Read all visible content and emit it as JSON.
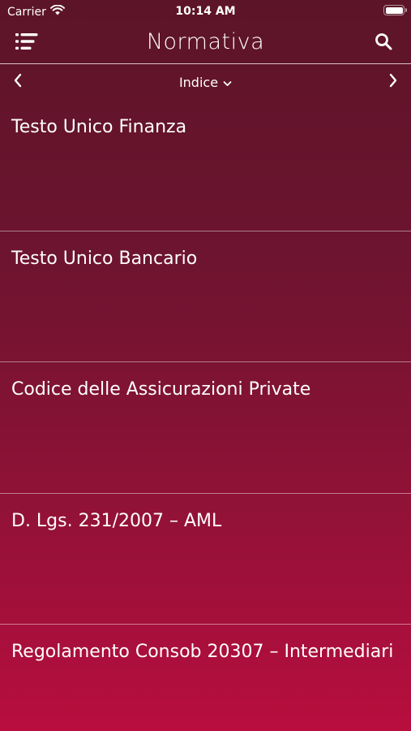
{
  "status_bar": {
    "carrier": "Carrier",
    "time": "10:14 AM",
    "battery_level": 1.0
  },
  "nav": {
    "title": "Normativa",
    "menu_icon": "list-menu-icon",
    "search_icon": "search-icon"
  },
  "sub_bar": {
    "index_label": "Indice",
    "prev_icon": "chevron-left-icon",
    "next_icon": "chevron-right-icon",
    "dropdown_icon": "chevron-down-icon"
  },
  "items": [
    {
      "label": "Testo Unico Finanza"
    },
    {
      "label": "Testo Unico Bancario"
    },
    {
      "label": "Codice delle Assicurazioni Private"
    },
    {
      "label": "D. Lgs. 231/2007 – AML"
    },
    {
      "label": "Regolamento Consob 20307 – Intermediari"
    }
  ],
  "colors": {
    "gradient_top": "#5c1428",
    "gradient_bottom": "#b80e3e",
    "text": "#ffffff"
  }
}
